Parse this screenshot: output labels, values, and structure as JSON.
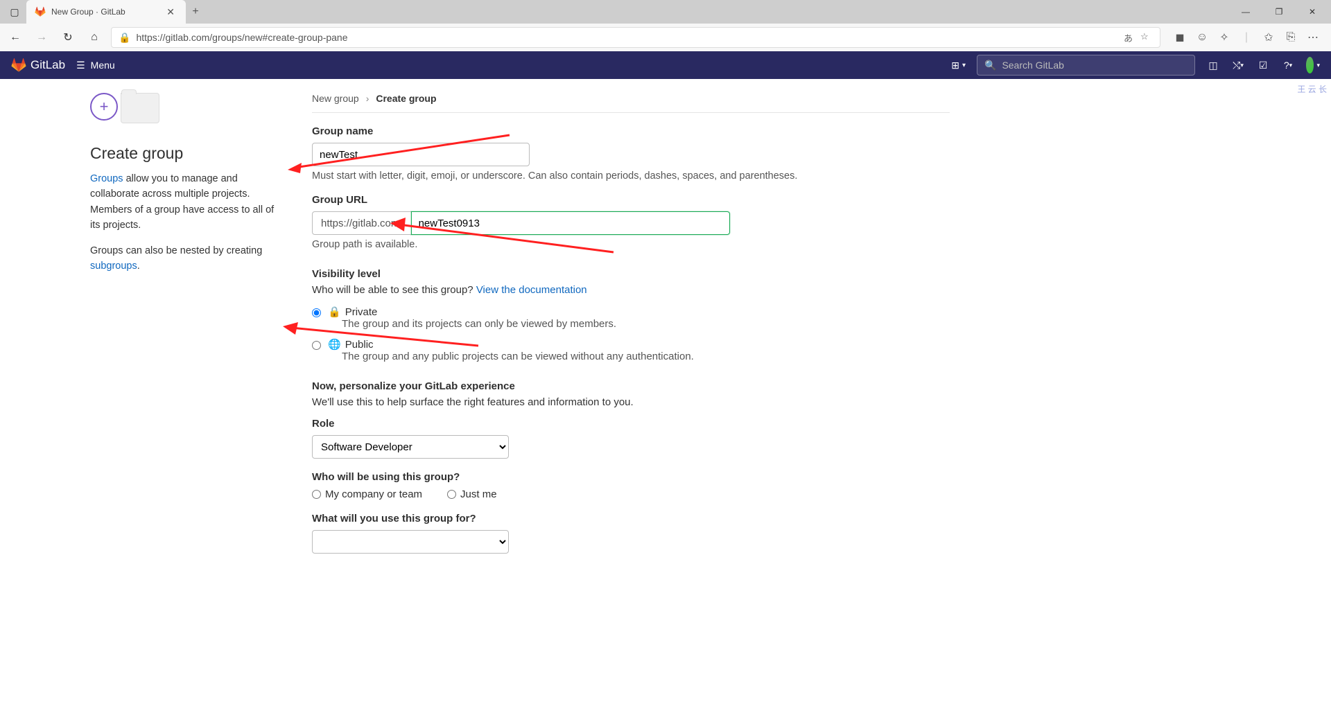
{
  "browser": {
    "tab_title": "New Group · GitLab",
    "url": "https://gitlab.com/groups/new#create-group-pane"
  },
  "header": {
    "brand": "GitLab",
    "menu": "Menu",
    "search_placeholder": "Search GitLab"
  },
  "sidebar": {
    "title": "Create group",
    "p1_pre": "Groups",
    "p1_post": " allow you to manage and collaborate across multiple projects. Members of a group have access to all of its projects.",
    "p2_pre": "Groups can also be nested by creating ",
    "p2_link": "subgroups",
    "p2_post": "."
  },
  "breadcrumb": {
    "parent": "New group",
    "current": "Create group"
  },
  "form": {
    "group_name_label": "Group name",
    "group_name_value": "newTest",
    "group_name_help": "Must start with letter, digit, emoji, or underscore. Can also contain periods, dashes, spaces, and parentheses.",
    "group_url_label": "Group URL",
    "group_url_prefix": "https://gitlab.com/",
    "group_url_value": "newTest0913",
    "group_url_status": "Group path is available.",
    "visibility_label": "Visibility level",
    "visibility_help_pre": "Who will be able to see this group? ",
    "visibility_help_link": "View the documentation",
    "visibility_options": [
      {
        "label": "Private",
        "desc": "The group and its projects can only be viewed by members.",
        "checked": true
      },
      {
        "label": "Public",
        "desc": "The group and any public projects can be viewed without any authentication.",
        "checked": false
      }
    ],
    "personalize_title": "Now, personalize your GitLab experience",
    "personalize_sub": "We'll use this to help surface the right features and information to you.",
    "role_label": "Role",
    "role_value": "Software Developer",
    "who_label": "Who will be using this group?",
    "who_options": [
      "My company or team",
      "Just me"
    ],
    "purpose_label": "What will you use this group for?"
  },
  "side_badge": "王\n云\n长"
}
